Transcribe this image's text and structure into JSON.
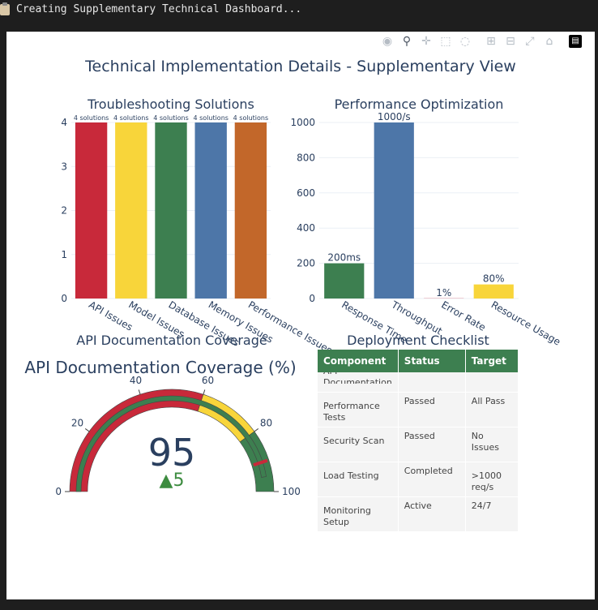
{
  "terminal": {
    "text": "Creating Supplementary Technical Dashboard..."
  },
  "main_title": "Technical Implementation Details - Supplementary View",
  "modebar": {
    "icons": [
      "camera-icon",
      "zoom-icon",
      "pan-icon",
      "box-select-icon",
      "lasso-icon",
      "zoom-in-icon",
      "zoom-out-icon",
      "autoscale-icon",
      "reset-axes-icon",
      "plotly-logo-icon"
    ]
  },
  "chart_data": [
    {
      "type": "bar",
      "title": "Troubleshooting Solutions",
      "categories": [
        "API Issues",
        "Model Issues",
        "Database Issues",
        "Memory Issues",
        "Performance Issues"
      ],
      "values": [
        4,
        4,
        4,
        4,
        4
      ],
      "data_labels": [
        "4 solutions",
        "4 solutions",
        "4 solutions",
        "4 solutions",
        "4 solutions"
      ],
      "colors": [
        "#c8293a",
        "#f8d53a",
        "#3d7f50",
        "#4d76a8",
        "#c2672a"
      ],
      "yticks": [
        0,
        1,
        2,
        3,
        4
      ],
      "ylim": [
        0,
        4
      ],
      "grid": true
    },
    {
      "type": "bar",
      "title": "Performance Optimization",
      "categories": [
        "Response Time",
        "Throughput",
        "Error Rate",
        "Resource Usage"
      ],
      "values": [
        200,
        1000,
        1,
        80
      ],
      "data_labels": [
        "200ms",
        "1000/s",
        "1%",
        "80%"
      ],
      "colors": [
        "#3d7f50",
        "#4d76a8",
        "#c8293a",
        "#f8d53a"
      ],
      "yticks": [
        0,
        200,
        400,
        600,
        800,
        1000
      ],
      "ylim": [
        0,
        1000
      ],
      "grid": true
    },
    {
      "type": "gauge",
      "subplot_title": "API Documentation Coverage",
      "title": "API Documentation Coverage (%)",
      "value": 95,
      "delta": "▲5",
      "reference": 90,
      "threshold": 90,
      "range": [
        0,
        100
      ],
      "ticks": [
        0,
        20,
        40,
        60,
        80,
        100
      ],
      "steps": [
        {
          "range": [
            0,
            60
          ],
          "color": "#c8293a"
        },
        {
          "range": [
            60,
            80
          ],
          "color": "#f8d53a"
        },
        {
          "range": [
            80,
            100
          ],
          "color": "#3d7f50"
        }
      ],
      "bar_color": "#3d7f50",
      "threshold_color": "#c8293a"
    },
    {
      "type": "table",
      "title": "Deployment Checklist",
      "header": [
        "Component",
        "Status",
        "Target"
      ],
      "rows": [
        [
          "API Documentation",
          "",
          ""
        ],
        [
          "Performance Tests",
          "Passed",
          "All Pass"
        ],
        [
          "Security Scan",
          "Passed",
          "No Issues"
        ],
        [
          "Load Testing",
          "Completed",
          ">1000 req/s"
        ],
        [
          "Monitoring Setup",
          "Active",
          "24/7"
        ]
      ]
    }
  ],
  "colors": {
    "header_green": "#3d7f50",
    "text": "#2a3f5f",
    "gauge_value": "#2a3f5f",
    "delta_green": "#3d8c40"
  }
}
